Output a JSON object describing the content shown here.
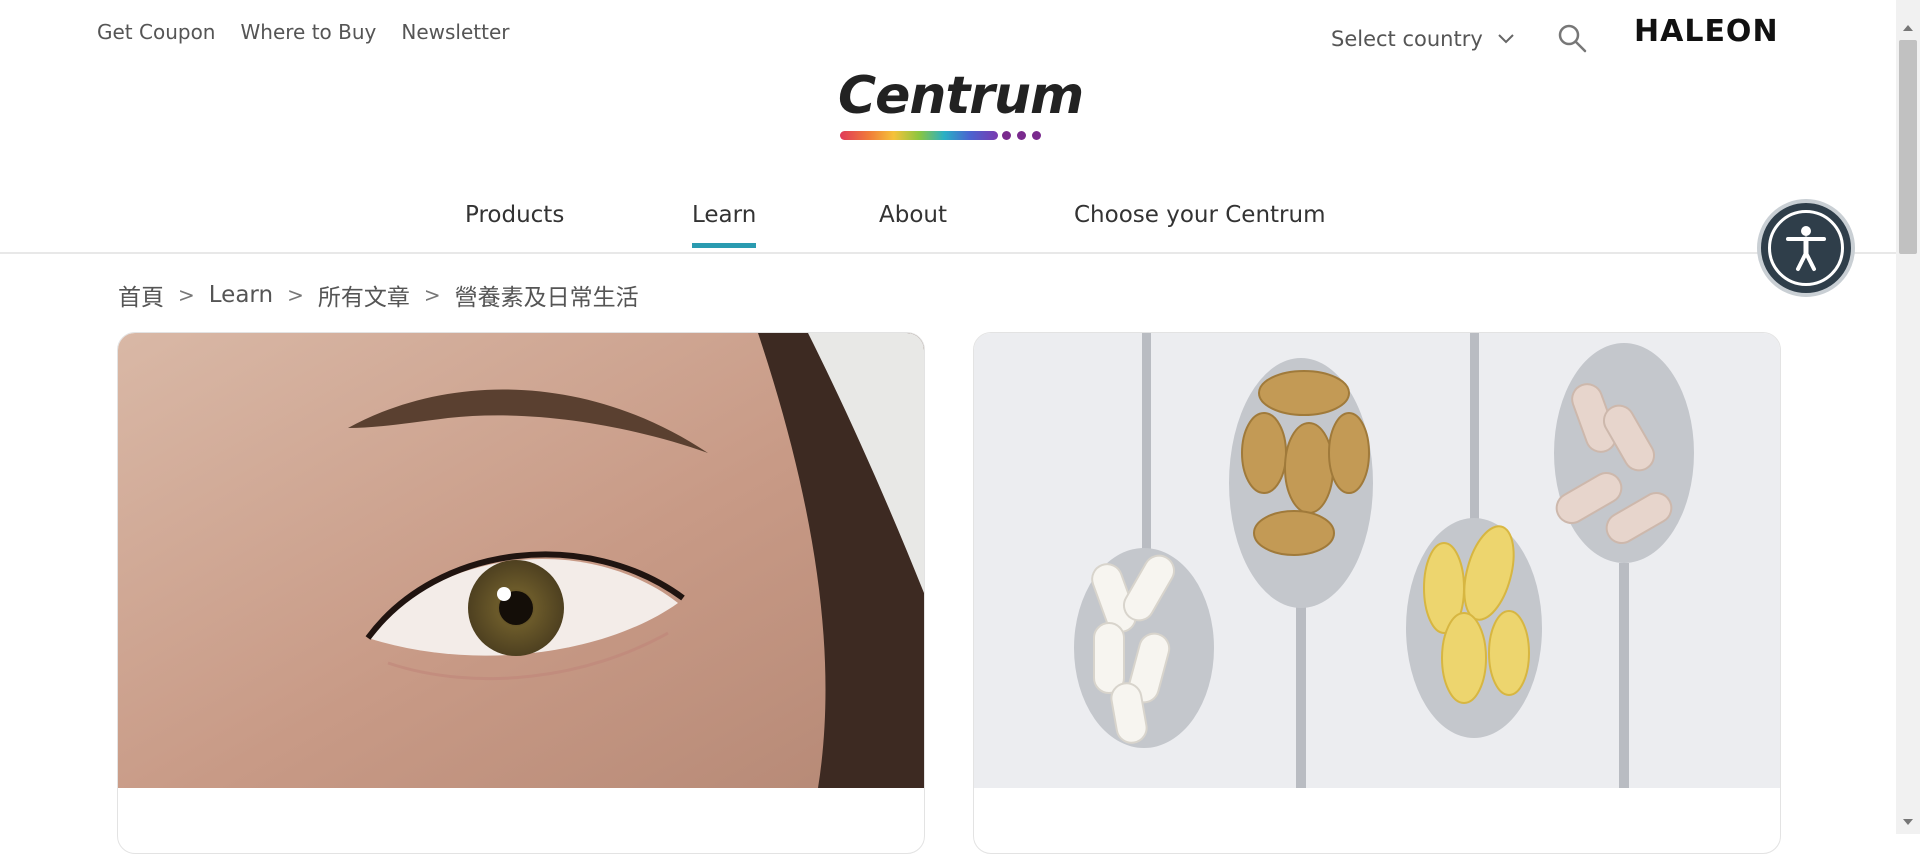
{
  "utility_nav": [
    "Get Coupon",
    "Where to Buy",
    "Newsletter"
  ],
  "country_selector": {
    "label": "Select country",
    "icon": "chevron-down-icon"
  },
  "search": {
    "icon": "search-icon"
  },
  "haleon_logo": "HALEON",
  "brand_logo": "Centrum",
  "main_nav": {
    "items": [
      {
        "label": "Products"
      },
      {
        "label": "Learn"
      },
      {
        "label": "About"
      },
      {
        "label": "Choose your Centrum"
      }
    ],
    "active": "Learn",
    "accent_color": "#2a9bb0"
  },
  "accessibility": {
    "icon": "accessibility-icon"
  },
  "breadcrumb": {
    "items": [
      "首頁",
      "Learn",
      "所有文章"
    ],
    "current": "營養素及日常生活",
    "separator": ">"
  },
  "cards": [
    {
      "image": "eye-closeup-photo"
    },
    {
      "image": "spoons-with-supplements-photo"
    }
  ]
}
